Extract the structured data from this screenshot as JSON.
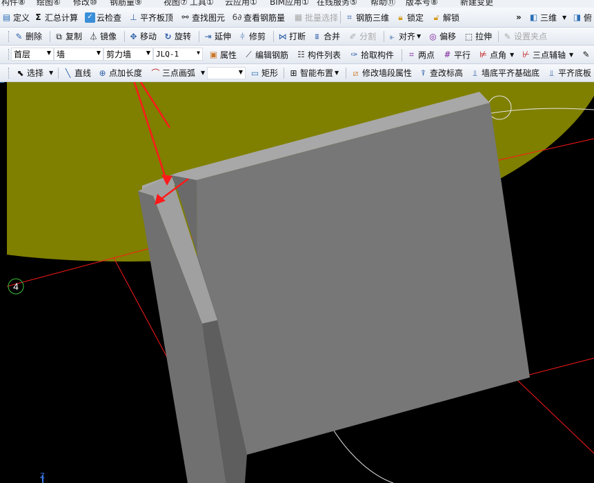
{
  "menubar": {
    "items": [
      "构件⑧",
      "绘图⑥",
      "修改⑩",
      "钢筋量⑨",
      "视图⑦",
      "工具①",
      "云应用①",
      "BIM应用①",
      "在线服务⑤",
      "帮助⑪",
      "版本号⑧",
      "新建变更"
    ]
  },
  "toolbar1": {
    "define": "定义",
    "sum_calc": "汇总计算",
    "cloud_check": "云检查",
    "level_slab": "平齐板顶",
    "find_element": "查找图元",
    "view_rebar": "查看钢筋量",
    "batch_select": "批量选择",
    "rebar_3d": "钢筋三维",
    "lock": "锁定",
    "unlock": "解锁",
    "more": "»",
    "view_3d": "三维",
    "view_cut": "俯"
  },
  "toolbar2": {
    "delete": "删除",
    "copy": "复制",
    "mirror": "镜像",
    "move": "移动",
    "rotate": "旋转",
    "extend": "延伸",
    "trim": "修剪",
    "break": "打断",
    "merge": "合并",
    "split": "分割",
    "align": "对齐",
    "offset": "偏移",
    "stretch": "拉伸",
    "set_grip": "设置夹点"
  },
  "toolbar3": {
    "floor": "首层",
    "category": "墙",
    "type": "剪力墙",
    "name": "JLQ-1",
    "properties": "属性",
    "edit_rebar": "编辑钢筋",
    "component_list": "构件列表",
    "pick_component": "拾取构件",
    "two_points": "两点",
    "parallel": "平行",
    "point_angle": "点角",
    "three_point_aux": "三点辅轴"
  },
  "toolbar4": {
    "select": "选择",
    "line": "直线",
    "point_length": "点加长度",
    "arc_3pt": "三点画弧",
    "shape_value": "",
    "rectangle": "矩形",
    "smart_layout": "智能布置",
    "edit_wall_props": "修改墙段属性",
    "check_elevation": "查改标高",
    "wall_bottom_align": "墙底平齐基础底",
    "align_slab_bottom": "平齐底板"
  },
  "viewport": {
    "axis_label": "4",
    "z_label": "Z",
    "colors": {
      "background": "#000000",
      "ground": "#7f7f00",
      "wall_face": "#757575",
      "wall_top": "#a8a8a8",
      "grid": "#ff1a1a",
      "annotation": "#ff1a1a"
    }
  }
}
